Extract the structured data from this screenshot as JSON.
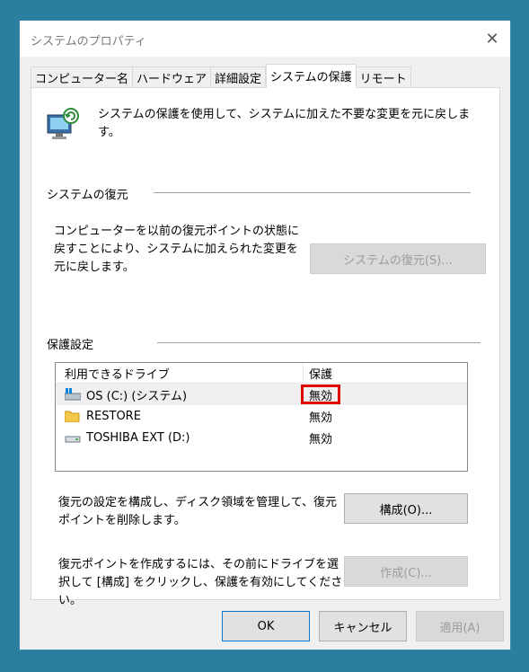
{
  "window": {
    "title": "システムのプロパティ"
  },
  "tabs": [
    {
      "label": "コンピューター名"
    },
    {
      "label": "ハードウェア"
    },
    {
      "label": "詳細設定"
    },
    {
      "label": "システムの保護"
    },
    {
      "label": "リモート"
    }
  ],
  "intro": {
    "text": "システムの保護を使用して、システムに加えた不要な変更を元に戻します。"
  },
  "restore": {
    "heading": "システムの復元",
    "description": "コンピューターを以前の復元ポイントの状態に戻すことにより、システムに加えられた変更を元に戻します。",
    "button": "システムの復元(S)..."
  },
  "protection": {
    "heading": "保護設定",
    "columns": {
      "drive": "利用できるドライブ",
      "protection": "保護"
    },
    "drives": [
      {
        "name": "OS (C:) (システム)",
        "status": "無効",
        "icon": "system-drive-icon"
      },
      {
        "name": "RESTORE",
        "status": "無効",
        "icon": "folder-icon"
      },
      {
        "name": "TOSHIBA EXT (D:)",
        "status": "無効",
        "icon": "external-drive-icon"
      }
    ],
    "configure_text": "復元の設定を構成し、ディスク領域を管理して、復元ポイントを削除します。",
    "configure_button": "構成(O)...",
    "create_text": "復元ポイントを作成するには、その前にドライブを選択して [構成] をクリックし、保護を有効にしてください。",
    "create_button": "作成(C)..."
  },
  "footer": {
    "ok": "OK",
    "cancel": "キャンセル",
    "apply": "適用(A)"
  },
  "colors": {
    "accent": "#0078d7",
    "highlight": "#e00000",
    "background": "#2a7f9e"
  }
}
